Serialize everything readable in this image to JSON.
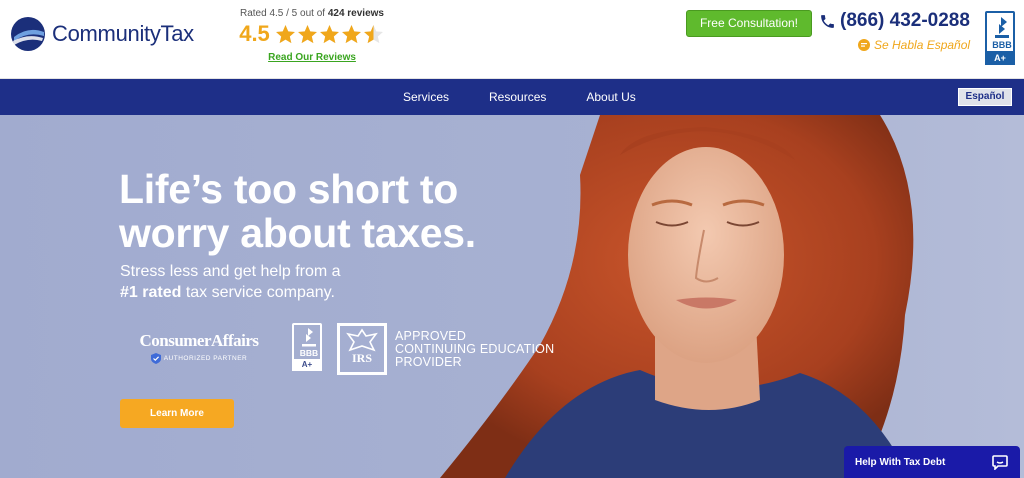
{
  "header": {
    "brand_name": "CommunityTax",
    "rating": {
      "prefix": "Rated 4.5 / 5 out of",
      "count": "424 reviews",
      "score": "4.5",
      "stars": 4.5,
      "max_stars": 5,
      "reviews_link": "Read Our Reviews"
    },
    "consult_button": "Free Consultation!",
    "phone": "(866) 432-0288",
    "spanish_note": "Se Habla Español",
    "bbb": {
      "label": "BBB",
      "grade": "A+"
    }
  },
  "nav": {
    "items": [
      {
        "label": "Services"
      },
      {
        "label": "Resources"
      },
      {
        "label": "About Us"
      }
    ],
    "language_button": "Español"
  },
  "hero": {
    "headline": "Life’s too short to worry about taxes.",
    "sub_line1": "Stress less and get help from a",
    "sub_bold": "#1 rated",
    "sub_line2_rest": " tax service company.",
    "consumer_affairs": {
      "name": "ConsumerAffairs",
      "tagline": "AUTHORIZED PARTNER"
    },
    "bbb": {
      "label": "BBB",
      "grade": "A+"
    },
    "irs": {
      "logo_text": "IRS",
      "line1": "APPROVED",
      "line2": "CONTINUING EDUCATION",
      "line3": "PROVIDER"
    },
    "cta_button": "Learn More"
  },
  "chat": {
    "label": "Help With Tax Debt"
  },
  "colors": {
    "brand_navy": "#1e2f88",
    "accent_orange": "#f6a822",
    "star_gold": "#f0a71b",
    "cta_green": "#5fba2d",
    "bbb_blue": "#1b5fa6",
    "chat_blue": "#1a1aa8"
  }
}
